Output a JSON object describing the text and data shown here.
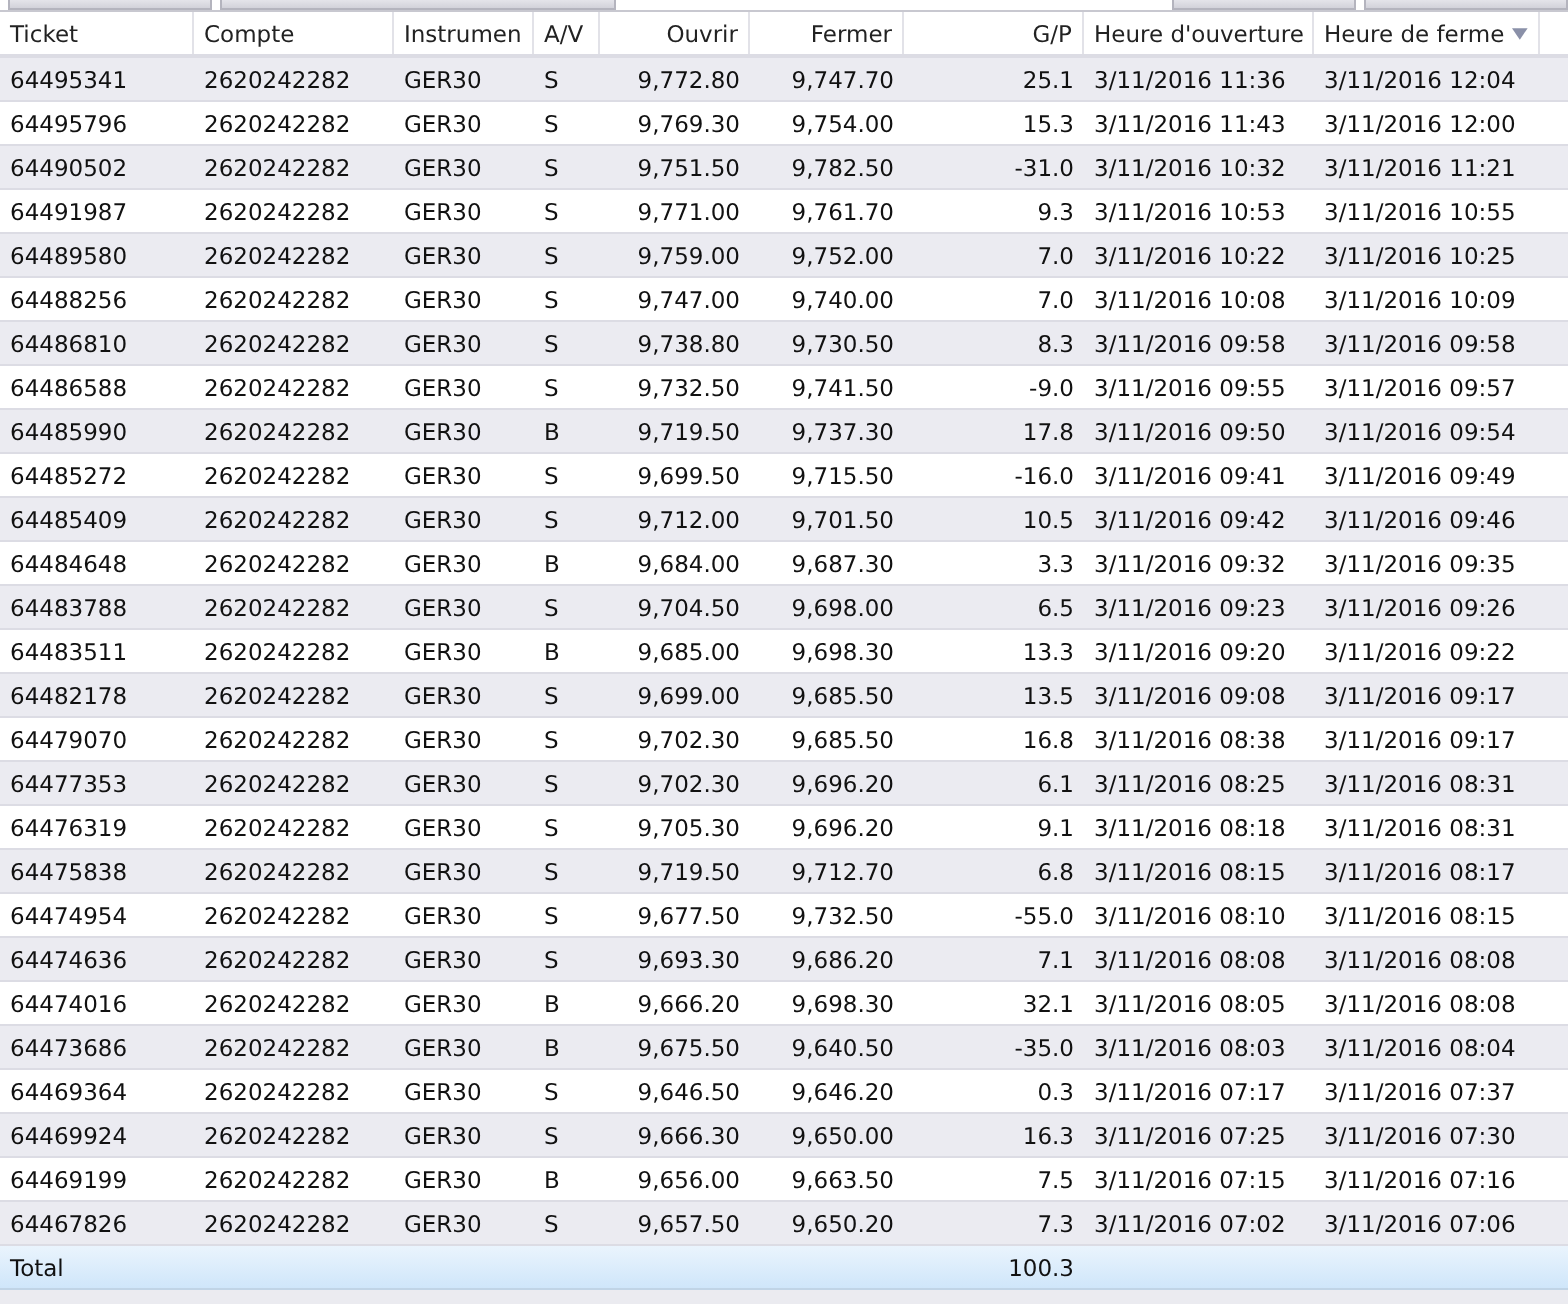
{
  "columns": [
    {
      "label": "Ticket",
      "kind": "text",
      "sorted": false
    },
    {
      "label": "Compte",
      "kind": "text",
      "sorted": false
    },
    {
      "label": "Instrumen",
      "kind": "text",
      "sorted": false
    },
    {
      "label": "A/V",
      "kind": "text",
      "sorted": false
    },
    {
      "label": "Ouvrir",
      "kind": "number",
      "sorted": false
    },
    {
      "label": "Fermer",
      "kind": "number",
      "sorted": false
    },
    {
      "label": "G/P",
      "kind": "number",
      "sorted": false
    },
    {
      "label": "Heure d'ouverture",
      "kind": "text",
      "sorted": false
    },
    {
      "label": "Heure de ferme",
      "kind": "text",
      "sorted": true
    }
  ],
  "rows": [
    [
      "64495341",
      "2620242282",
      "GER30",
      "S",
      "9,772.80",
      "9,747.70",
      "25.1",
      "3/11/2016 11:36",
      "3/11/2016 12:04"
    ],
    [
      "64495796",
      "2620242282",
      "GER30",
      "S",
      "9,769.30",
      "9,754.00",
      "15.3",
      "3/11/2016 11:43",
      "3/11/2016 12:00"
    ],
    [
      "64490502",
      "2620242282",
      "GER30",
      "S",
      "9,751.50",
      "9,782.50",
      "-31.0",
      "3/11/2016 10:32",
      "3/11/2016 11:21"
    ],
    [
      "64491987",
      "2620242282",
      "GER30",
      "S",
      "9,771.00",
      "9,761.70",
      "9.3",
      "3/11/2016 10:53",
      "3/11/2016 10:55"
    ],
    [
      "64489580",
      "2620242282",
      "GER30",
      "S",
      "9,759.00",
      "9,752.00",
      "7.0",
      "3/11/2016 10:22",
      "3/11/2016 10:25"
    ],
    [
      "64488256",
      "2620242282",
      "GER30",
      "S",
      "9,747.00",
      "9,740.00",
      "7.0",
      "3/11/2016 10:08",
      "3/11/2016 10:09"
    ],
    [
      "64486810",
      "2620242282",
      "GER30",
      "S",
      "9,738.80",
      "9,730.50",
      "8.3",
      "3/11/2016 09:58",
      "3/11/2016 09:58"
    ],
    [
      "64486588",
      "2620242282",
      "GER30",
      "S",
      "9,732.50",
      "9,741.50",
      "-9.0",
      "3/11/2016 09:55",
      "3/11/2016 09:57"
    ],
    [
      "64485990",
      "2620242282",
      "GER30",
      "B",
      "9,719.50",
      "9,737.30",
      "17.8",
      "3/11/2016 09:50",
      "3/11/2016 09:54"
    ],
    [
      "64485272",
      "2620242282",
      "GER30",
      "S",
      "9,699.50",
      "9,715.50",
      "-16.0",
      "3/11/2016 09:41",
      "3/11/2016 09:49"
    ],
    [
      "64485409",
      "2620242282",
      "GER30",
      "S",
      "9,712.00",
      "9,701.50",
      "10.5",
      "3/11/2016 09:42",
      "3/11/2016 09:46"
    ],
    [
      "64484648",
      "2620242282",
      "GER30",
      "B",
      "9,684.00",
      "9,687.30",
      "3.3",
      "3/11/2016 09:32",
      "3/11/2016 09:35"
    ],
    [
      "64483788",
      "2620242282",
      "GER30",
      "S",
      "9,704.50",
      "9,698.00",
      "6.5",
      "3/11/2016 09:23",
      "3/11/2016 09:26"
    ],
    [
      "64483511",
      "2620242282",
      "GER30",
      "B",
      "9,685.00",
      "9,698.30",
      "13.3",
      "3/11/2016 09:20",
      "3/11/2016 09:22"
    ],
    [
      "64482178",
      "2620242282",
      "GER30",
      "S",
      "9,699.00",
      "9,685.50",
      "13.5",
      "3/11/2016 09:08",
      "3/11/2016 09:17"
    ],
    [
      "64479070",
      "2620242282",
      "GER30",
      "S",
      "9,702.30",
      "9,685.50",
      "16.8",
      "3/11/2016 08:38",
      "3/11/2016 09:17"
    ],
    [
      "64477353",
      "2620242282",
      "GER30",
      "S",
      "9,702.30",
      "9,696.20",
      "6.1",
      "3/11/2016 08:25",
      "3/11/2016 08:31"
    ],
    [
      "64476319",
      "2620242282",
      "GER30",
      "S",
      "9,705.30",
      "9,696.20",
      "9.1",
      "3/11/2016 08:18",
      "3/11/2016 08:31"
    ],
    [
      "64475838",
      "2620242282",
      "GER30",
      "S",
      "9,719.50",
      "9,712.70",
      "6.8",
      "3/11/2016 08:15",
      "3/11/2016 08:17"
    ],
    [
      "64474954",
      "2620242282",
      "GER30",
      "S",
      "9,677.50",
      "9,732.50",
      "-55.0",
      "3/11/2016 08:10",
      "3/11/2016 08:15"
    ],
    [
      "64474636",
      "2620242282",
      "GER30",
      "S",
      "9,693.30",
      "9,686.20",
      "7.1",
      "3/11/2016 08:08",
      "3/11/2016 08:08"
    ],
    [
      "64474016",
      "2620242282",
      "GER30",
      "B",
      "9,666.20",
      "9,698.30",
      "32.1",
      "3/11/2016 08:05",
      "3/11/2016 08:08"
    ],
    [
      "64473686",
      "2620242282",
      "GER30",
      "B",
      "9,675.50",
      "9,640.50",
      "-35.0",
      "3/11/2016 08:03",
      "3/11/2016 08:04"
    ],
    [
      "64469364",
      "2620242282",
      "GER30",
      "S",
      "9,646.50",
      "9,646.20",
      "0.3",
      "3/11/2016 07:17",
      "3/11/2016 07:37"
    ],
    [
      "64469924",
      "2620242282",
      "GER30",
      "S",
      "9,666.30",
      "9,650.00",
      "16.3",
      "3/11/2016 07:25",
      "3/11/2016 07:30"
    ],
    [
      "64469199",
      "2620242282",
      "GER30",
      "B",
      "9,656.00",
      "9,663.50",
      "7.5",
      "3/11/2016 07:15",
      "3/11/2016 07:16"
    ],
    [
      "64467826",
      "2620242282",
      "GER30",
      "S",
      "9,657.50",
      "9,650.20",
      "7.3",
      "3/11/2016 07:02",
      "3/11/2016 07:06"
    ]
  ],
  "total": {
    "label": "Total",
    "value": "100.3"
  }
}
